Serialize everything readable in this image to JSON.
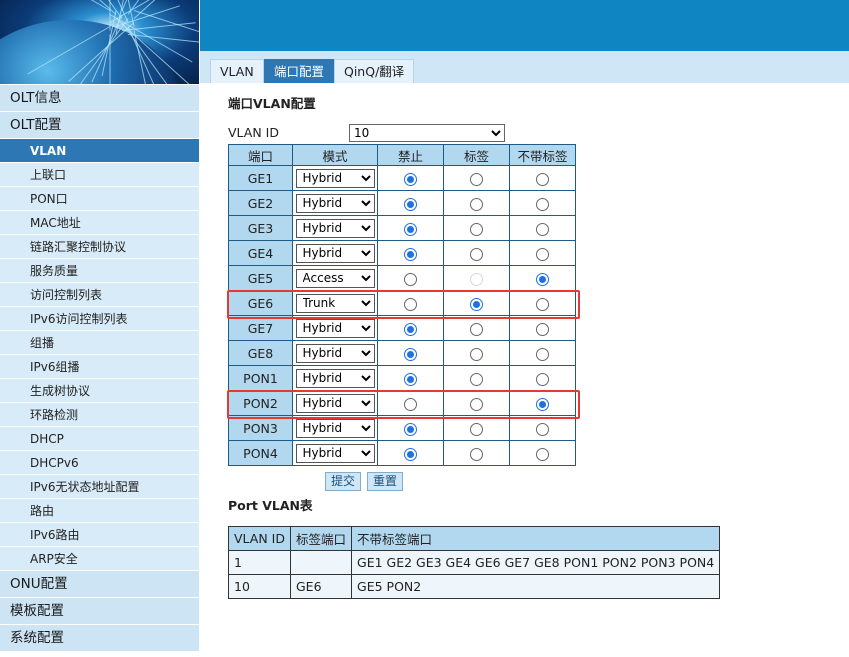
{
  "sidebar": {
    "items": [
      {
        "label": "OLT信息",
        "level": "top"
      },
      {
        "label": "OLT配置",
        "level": "top"
      },
      {
        "label": "VLAN",
        "level": "sub",
        "active": true
      },
      {
        "label": "上联口",
        "level": "sub"
      },
      {
        "label": "PON口",
        "level": "sub"
      },
      {
        "label": "MAC地址",
        "level": "sub"
      },
      {
        "label": "链路汇聚控制协议",
        "level": "sub"
      },
      {
        "label": "服务质量",
        "level": "sub"
      },
      {
        "label": "访问控制列表",
        "level": "sub"
      },
      {
        "label": "IPv6访问控制列表",
        "level": "sub"
      },
      {
        "label": "组播",
        "level": "sub"
      },
      {
        "label": "IPv6组播",
        "level": "sub"
      },
      {
        "label": "生成树协议",
        "level": "sub"
      },
      {
        "label": "环路检测",
        "level": "sub"
      },
      {
        "label": "DHCP",
        "level": "sub"
      },
      {
        "label": "DHCPv6",
        "level": "sub"
      },
      {
        "label": "IPv6无状态地址配置",
        "level": "sub"
      },
      {
        "label": "路由",
        "level": "sub"
      },
      {
        "label": "IPv6路由",
        "level": "sub"
      },
      {
        "label": "ARP安全",
        "level": "sub"
      },
      {
        "label": "ONU配置",
        "level": "top"
      },
      {
        "label": "模板配置",
        "level": "top"
      },
      {
        "label": "系统配置",
        "level": "top"
      }
    ]
  },
  "tabs": [
    {
      "label": "VLAN",
      "active": false
    },
    {
      "label": "端口配置",
      "active": true
    },
    {
      "label": "QinQ/翻译",
      "active": false
    }
  ],
  "main": {
    "title": "端口VLAN配置",
    "vlan_id_label": "VLAN ID",
    "vlan_id_value": "10",
    "columns": [
      "端口",
      "模式",
      "禁止",
      "标签",
      "不带标签"
    ],
    "rows": [
      {
        "port": "GE1",
        "mode": "Hybrid",
        "selected": "forbid"
      },
      {
        "port": "GE2",
        "mode": "Hybrid",
        "selected": "forbid"
      },
      {
        "port": "GE3",
        "mode": "Hybrid",
        "selected": "forbid"
      },
      {
        "port": "GE4",
        "mode": "Hybrid",
        "selected": "forbid"
      },
      {
        "port": "GE5",
        "mode": "Access",
        "selected": "untag",
        "tag_disabled": true
      },
      {
        "port": "GE6",
        "mode": "Trunk",
        "selected": "tag",
        "highlighted": true
      },
      {
        "port": "GE7",
        "mode": "Hybrid",
        "selected": "forbid"
      },
      {
        "port": "GE8",
        "mode": "Hybrid",
        "selected": "forbid"
      },
      {
        "port": "PON1",
        "mode": "Hybrid",
        "selected": "forbid"
      },
      {
        "port": "PON2",
        "mode": "Hybrid",
        "selected": "untag",
        "highlighted": true
      },
      {
        "port": "PON3",
        "mode": "Hybrid",
        "selected": "forbid"
      },
      {
        "port": "PON4",
        "mode": "Hybrid",
        "selected": "forbid"
      }
    ],
    "submit_label": "提交",
    "reset_label": "重置",
    "highlight_color": "#e53935"
  },
  "port_vlan_table": {
    "title": "Port VLAN表",
    "columns": [
      "VLAN ID",
      "标签端口",
      "不带标签端口"
    ],
    "rows": [
      [
        "1",
        "",
        "GE1 GE2 GE3 GE4 GE6 GE7 GE8 PON1 PON2 PON3 PON4"
      ],
      [
        "10",
        "GE6",
        "GE5 PON2"
      ]
    ]
  },
  "colors": {
    "header": "#0f86c1",
    "accent": "#2c77b4",
    "nav_bg": "#cde4f4",
    "table_head": "#b2d8ef"
  }
}
